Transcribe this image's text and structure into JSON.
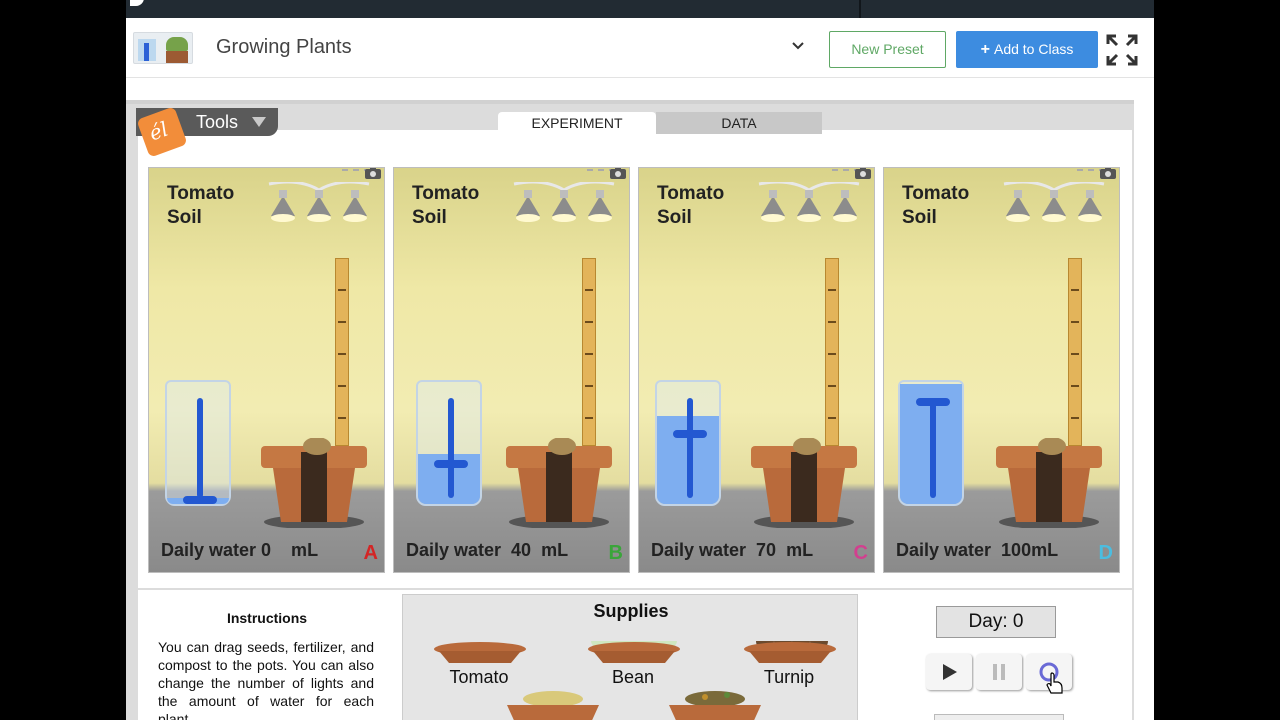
{
  "header": {
    "title": "Growing Plants",
    "new_preset_label": "New Preset",
    "add_to_class_label": "Add to Class",
    "add_icon": "plus-icon",
    "fullscreen_icon": "expand-icon"
  },
  "sim": {
    "tools_label": "Tools",
    "tabs": [
      {
        "label": "EXPERIMENT",
        "active": true
      },
      {
        "label": "DATA",
        "active": false
      }
    ],
    "panels": [
      {
        "plant": "Tomato",
        "medium": "Soil",
        "water_text": "Daily water 0    mL",
        "water_ml": 0,
        "letter": "A",
        "letter_color": "#d32626"
      },
      {
        "plant": "Tomato",
        "medium": "Soil",
        "water_text": "Daily water  40  mL",
        "water_ml": 40,
        "letter": "B",
        "letter_color": "#3aa53a"
      },
      {
        "plant": "Tomato",
        "medium": "Soil",
        "water_text": "Daily water  70  mL",
        "water_ml": 70,
        "letter": "C",
        "letter_color": "#d1408f"
      },
      {
        "plant": "Tomato",
        "medium": "Soil",
        "water_text": "Daily water  100mL",
        "water_ml": 100,
        "letter": "D",
        "letter_color": "#4bbde0"
      }
    ],
    "instructions": {
      "title": "Instructions",
      "text": "You can drag seeds, fertilizer, and compost to the pots. You can also change the number of lights and the amount of water for each plant."
    },
    "supplies": {
      "title": "Supplies",
      "items": [
        "Tomato",
        "Bean",
        "Turnip"
      ]
    },
    "day_label": "Day: 0",
    "colors": {
      "accent": "#3d8ce0",
      "preset_green": "#5fa865",
      "water": "#7eaef0",
      "indicator": "#2358d1"
    }
  }
}
